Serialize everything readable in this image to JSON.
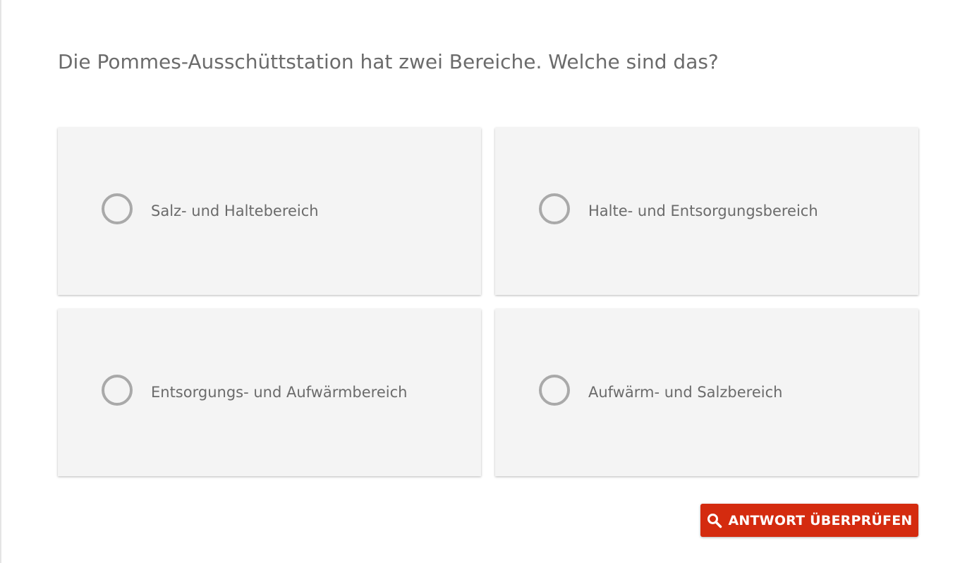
{
  "quiz": {
    "question": "Die Pommes-Ausschüttstation hat zwei Bereiche. Welche sind das?",
    "options": [
      {
        "label": "Salz- und Haltebereich",
        "selected": false
      },
      {
        "label": "Halte- und Entsorgungsbereich",
        "selected": false
      },
      {
        "label": "Entsorgungs- und Aufwärmbereich",
        "selected": false
      },
      {
        "label": "Aufwärm- und Salzbereich",
        "selected": false
      }
    ],
    "check_button": {
      "label": "ANTWORT ÜBERPRÜFEN",
      "icon": "search-icon"
    }
  },
  "colors": {
    "accent": "#d42b0f",
    "card_background": "#f4f4f4",
    "text": "#6b6b6b",
    "radio_border": "#a9a9a9"
  }
}
